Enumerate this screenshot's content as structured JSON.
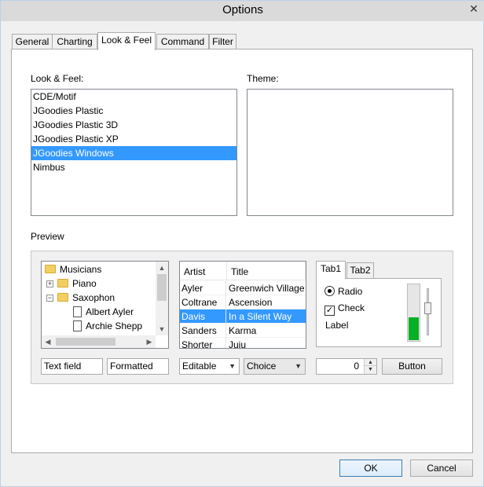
{
  "window": {
    "title": "Options",
    "close_glyph": "✕"
  },
  "tabs": [
    {
      "label": "General"
    },
    {
      "label": "Charting"
    },
    {
      "label": "Look & Feel",
      "active": true
    },
    {
      "label": "Command"
    },
    {
      "label": "Filter"
    }
  ],
  "look_feel": {
    "label": "Look & Feel:",
    "items": [
      "CDE/Motif",
      "JGoodies Plastic",
      "JGoodies Plastic 3D",
      "JGoodies Plastic XP",
      "JGoodies Windows",
      "Nimbus"
    ],
    "selected": "JGoodies Windows"
  },
  "theme": {
    "label": "Theme:"
  },
  "preview": {
    "label": "Preview",
    "tree": {
      "items": [
        {
          "label": "Musicians",
          "icon": "folder-icon",
          "expander": ""
        },
        {
          "label": "Piano",
          "icon": "folder-icon",
          "expander": "+"
        },
        {
          "label": "Saxophon",
          "icon": "folder-icon",
          "expander": "−"
        },
        {
          "label": "Albert Ayler",
          "icon": "file-icon"
        },
        {
          "label": "Archie Shepp",
          "icon": "file-icon"
        }
      ]
    },
    "table": {
      "columns": [
        "Artist",
        "Title"
      ],
      "rows": [
        [
          "Ayler",
          "Greenwich Village"
        ],
        [
          "Coltrane",
          "Ascension"
        ],
        [
          "Davis",
          "In a Silent Way"
        ],
        [
          "Sanders",
          "Karma"
        ],
        [
          "Shorter",
          "Juju"
        ]
      ],
      "selected_row": 2
    },
    "mini_tabs": [
      {
        "label": "Tab1",
        "active": true
      },
      {
        "label": "Tab2"
      }
    ],
    "radio_label": "Radio",
    "check_label": "Check",
    "check_glyph": "✓",
    "static_label": "Label",
    "progress_value": 0.42,
    "text_field": "Text field",
    "formatted_field": "Formatted",
    "editable_combo": "Editable",
    "choice_combo": "Choice",
    "spinner_value": "0",
    "button_label": "Button"
  },
  "dialog": {
    "ok": "OK",
    "cancel": "Cancel"
  },
  "colors": {
    "selection": "#3399ff",
    "progress": "#06b025"
  }
}
